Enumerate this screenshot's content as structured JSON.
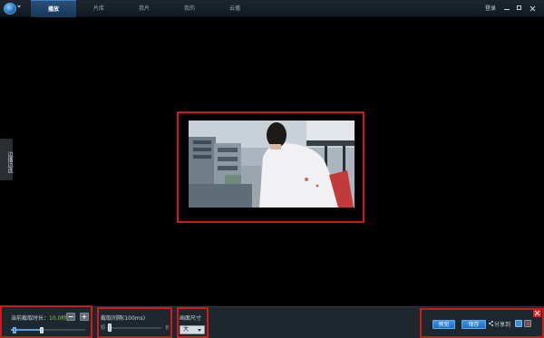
{
  "titlebar": {
    "tabs": [
      {
        "label": "播放",
        "active": true
      },
      {
        "label": "片库",
        "active": false
      },
      {
        "label": "我片",
        "active": false
      },
      {
        "label": "我的",
        "active": false
      },
      {
        "label": "云播",
        "active": false
      }
    ],
    "login_label": "登录"
  },
  "side_tab": {
    "label": "边播边选"
  },
  "capture": {
    "duration_label": "当前截取时长：",
    "duration_value": "10.0秒",
    "minus": "−",
    "plus": "+",
    "interval_label": "截取间隔(100ms)",
    "interval_min": "短",
    "interval_max": "长",
    "size_label": "画面尺寸",
    "size_value": "大"
  },
  "actions": {
    "preview_label": "预览",
    "save_label": "保存",
    "share_label": "分享到"
  },
  "colors": {
    "accent": "#1f6fc0",
    "highlight_box": "#d01a1a",
    "value_green": "#7fd04b"
  }
}
